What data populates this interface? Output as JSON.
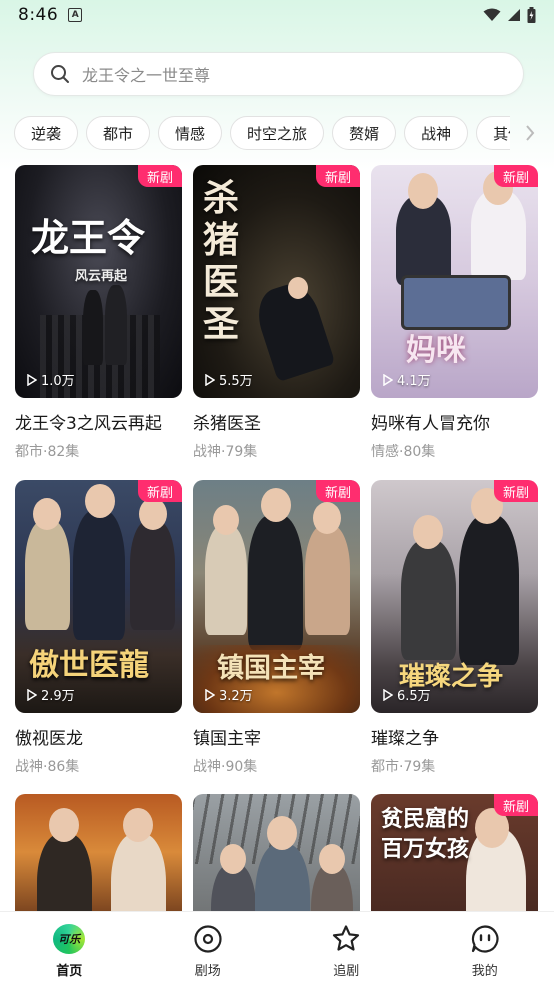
{
  "status": {
    "time": "8:46",
    "notification_icon": "A"
  },
  "search": {
    "placeholder": "龙王令之一世至尊"
  },
  "tags": [
    "逆袭",
    "都市",
    "情感",
    "时空之旅",
    "赘婿",
    "战神",
    "其他"
  ],
  "cards": [
    {
      "title": "龙王令3之风云再起",
      "meta": "都市·82集",
      "plays": "1.0万",
      "badge": "新剧",
      "poster_text": "龙王令",
      "poster_sub": "风云再起"
    },
    {
      "title": "杀猪医圣",
      "meta": "战神·79集",
      "plays": "5.5万",
      "badge": "新剧",
      "poster_text": "杀猪医圣",
      "poster_sub": ""
    },
    {
      "title": "妈咪有人冒充你",
      "meta": "情感·80集",
      "plays": "4.1万",
      "badge": "新剧",
      "poster_text": "妈咪",
      "poster_sub": ""
    },
    {
      "title": "傲视医龙",
      "meta": "战神·86集",
      "plays": "2.9万",
      "badge": "新剧",
      "poster_text": "傲世医龍",
      "poster_sub": ""
    },
    {
      "title": "镇国主宰",
      "meta": "战神·90集",
      "plays": "3.2万",
      "badge": "新剧",
      "poster_text": "镇国主宰",
      "poster_sub": ""
    },
    {
      "title": "璀璨之争",
      "meta": "都市·79集",
      "plays": "6.5万",
      "badge": "新剧",
      "poster_text": "璀璨之争",
      "poster_sub": ""
    },
    {
      "title": "",
      "meta": "",
      "plays": "",
      "badge": "",
      "poster_text": "",
      "poster_sub": ""
    },
    {
      "title": "",
      "meta": "",
      "plays": "",
      "badge": "",
      "poster_text": "",
      "poster_sub": ""
    },
    {
      "title": "",
      "meta": "",
      "plays": "",
      "badge": "新剧",
      "poster_text": "贫民窟的百万女孩",
      "poster_sub": ""
    }
  ],
  "nav": {
    "home": {
      "label": "首页",
      "logo": "可乐",
      "icon": "home-logo-icon"
    },
    "theater": {
      "label": "剧场",
      "icon": "theater-icon"
    },
    "follow": {
      "label": "追剧",
      "icon": "star-icon"
    },
    "mine": {
      "label": "我的",
      "icon": "chat-face-icon"
    }
  },
  "colors": {
    "accent": "#ff2d6f",
    "brand_green": "#34d399"
  }
}
